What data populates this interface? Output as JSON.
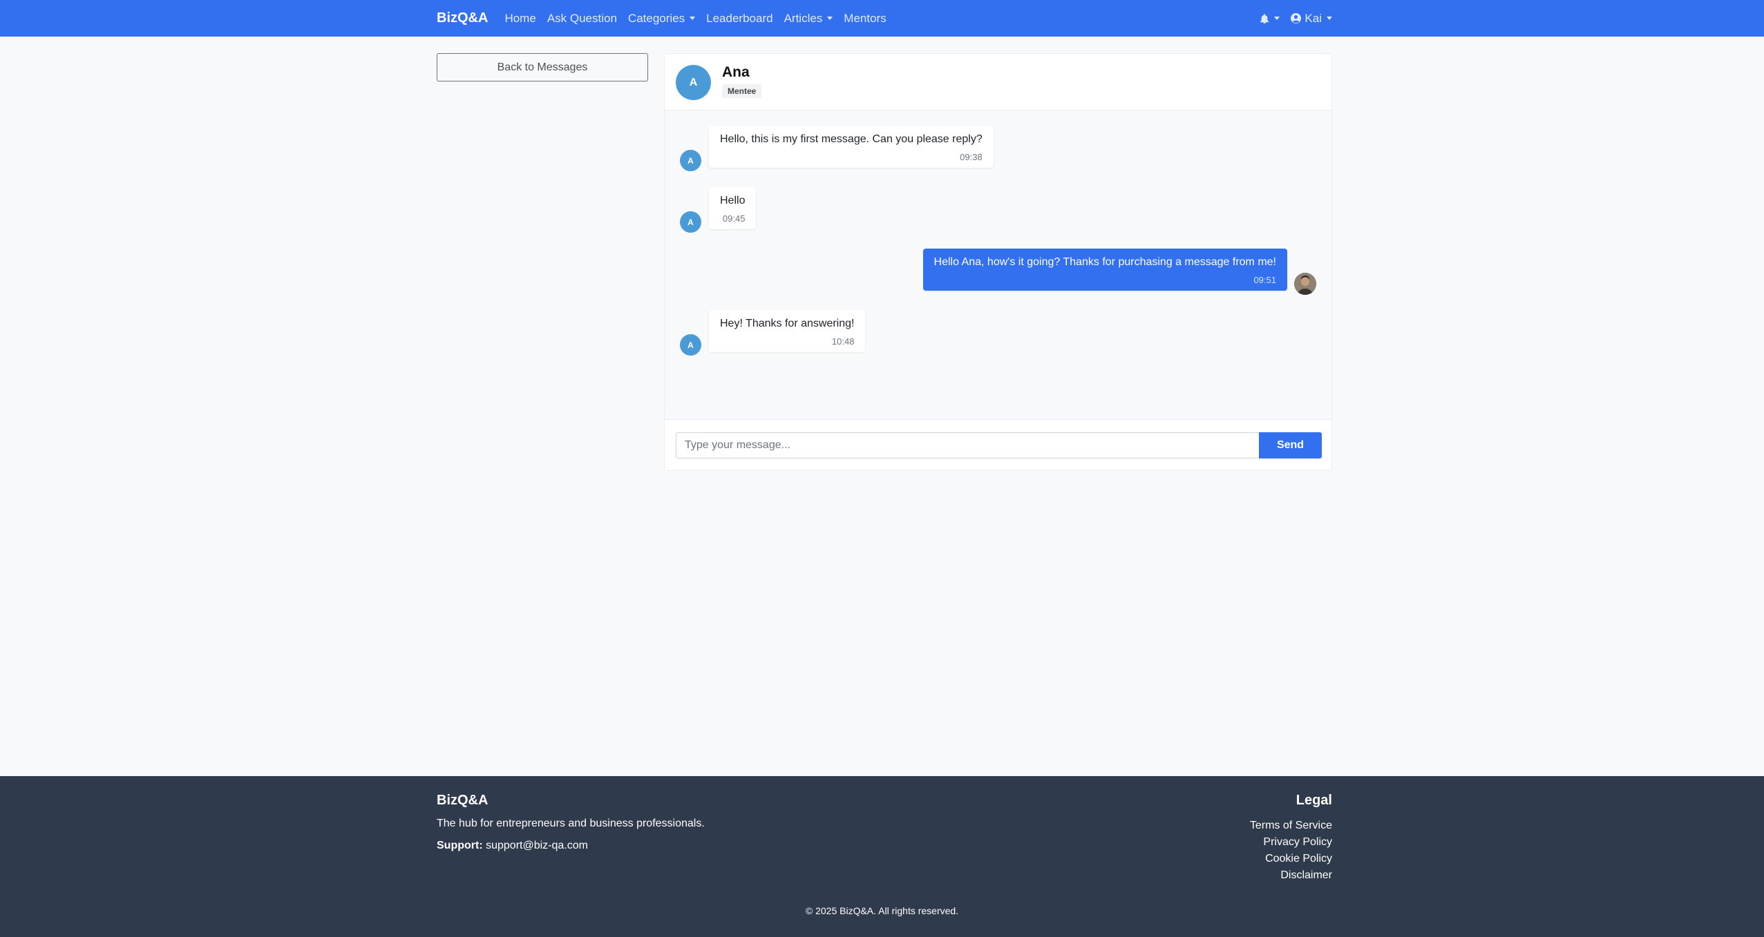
{
  "navbar": {
    "brand": "BizQ&A",
    "links": [
      "Home",
      "Ask Question",
      "Categories",
      "Leaderboard",
      "Articles",
      "Mentors"
    ],
    "user_name": "Kai",
    "icons": {
      "notifications": "bell-icon",
      "user": "user-circle-icon"
    },
    "bg_color": "#3370f0"
  },
  "sidebar": {
    "back_label": "Back to Messages"
  },
  "chat": {
    "contact_initial": "A",
    "contact_name": "Ana",
    "contact_role": "Mentee",
    "avatar_color": "#4a9ad8",
    "messages": [
      {
        "from": "contact",
        "initial": "A",
        "text": "Hello, this is my first message. Can you please reply?",
        "time": "09:38"
      },
      {
        "from": "contact",
        "initial": "A",
        "text": "Hello",
        "time": "09:45"
      },
      {
        "from": "self",
        "text": "Hello Ana, how's it going? Thanks for purchasing a message from me!",
        "time": "09:51"
      },
      {
        "from": "contact",
        "initial": "A",
        "text": "Hey! Thanks for answering!",
        "time": "10:48"
      }
    ],
    "input_placeholder": "Type your message...",
    "send_label": "Send"
  },
  "footer": {
    "brand": "BizQ&A",
    "tagline": "The hub for entrepreneurs and business professionals.",
    "support_label": "Support:",
    "support_email": "support@biz-qa.com",
    "legal_title": "Legal",
    "legal_links": [
      "Terms of Service",
      "Privacy Policy",
      "Cookie Policy",
      "Disclaimer"
    ],
    "copyright": "© 2025 BizQ&A. All rights reserved.",
    "bg_color": "#2f3a4c"
  }
}
